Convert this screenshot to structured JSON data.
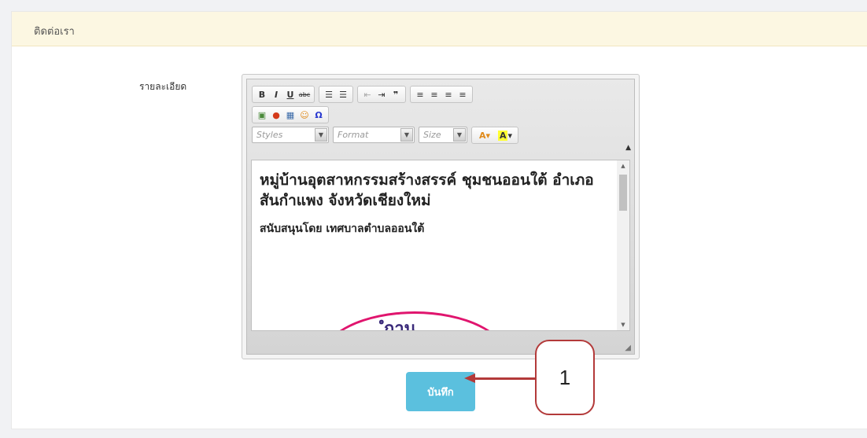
{
  "panel": {
    "title": "ติดต่อเรา"
  },
  "form": {
    "detail_label": "รายละเอียด"
  },
  "toolbar": {
    "row1": [
      {
        "name": "bold-button",
        "glyph": "B"
      },
      {
        "name": "italic-button",
        "glyph": "I"
      },
      {
        "name": "underline-button",
        "glyph": "U"
      },
      {
        "name": "strikethrough-button",
        "glyph": "abc"
      },
      {
        "name": "numbered-list-button",
        "glyph": "☰"
      },
      {
        "name": "bulleted-list-button",
        "glyph": "☰"
      },
      {
        "name": "outdent-button",
        "glyph": "⇤"
      },
      {
        "name": "indent-button",
        "glyph": "⇥"
      },
      {
        "name": "blockquote-button",
        "glyph": "❞"
      },
      {
        "name": "align-left-button",
        "glyph": "≡"
      },
      {
        "name": "align-center-button",
        "glyph": "≡"
      },
      {
        "name": "align-right-button",
        "glyph": "≡"
      },
      {
        "name": "justify-button",
        "glyph": "≡"
      }
    ],
    "row2": [
      {
        "name": "image-button",
        "glyph": "▣"
      },
      {
        "name": "flash-button",
        "glyph": "●"
      },
      {
        "name": "table-button",
        "glyph": "▦"
      },
      {
        "name": "smiley-button",
        "glyph": "☺"
      },
      {
        "name": "special-char-button",
        "glyph": "Ω"
      }
    ],
    "styles_placeholder": "Styles",
    "format_placeholder": "Format",
    "size_placeholder": "Size",
    "text_color_glyph": "A",
    "bg_color_glyph": "A"
  },
  "editor": {
    "heading": "หมู่บ้านอุตสาหกรรมสร้างสรรค์ ชุมชนออนใต้ อำเภอสันกำแพง จังหวัดเชียงใหม่",
    "subtext": "สนับสนุนโดย เทศบาลตำบลออนใต้",
    "logo_text": "ํกาน"
  },
  "actions": {
    "save_label": "บันทึก"
  },
  "annotation": {
    "callout_number": "1"
  },
  "colors": {
    "save_button": "#5bc0de",
    "callout_border": "#b33a3a",
    "panel_heading_bg": "#fcf7e2",
    "logo_ring": "#e0156e"
  }
}
